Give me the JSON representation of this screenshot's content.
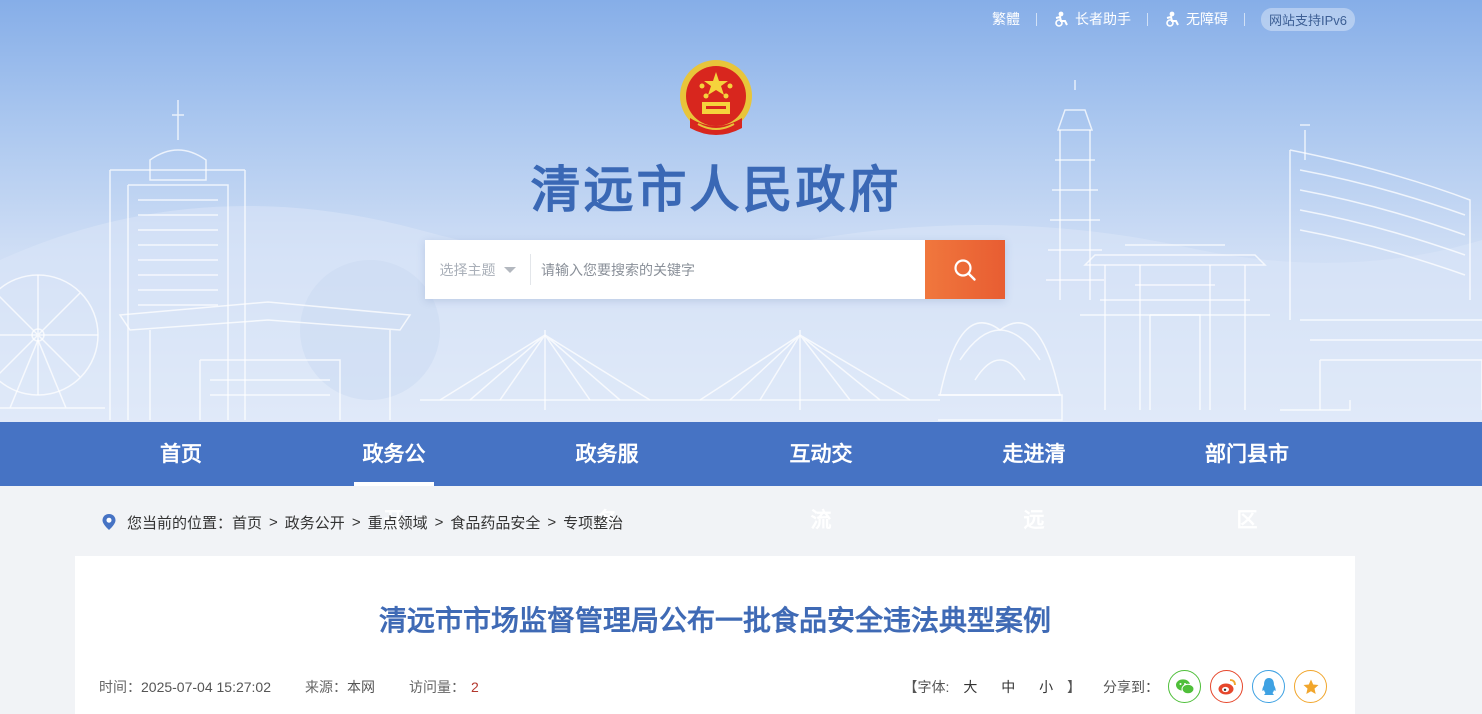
{
  "toplinks": {
    "traditional": "繁體",
    "elder": "长者助手",
    "accessible": "无障碍",
    "ipv6": "网站支持IPv6"
  },
  "site": {
    "title": "清远市人民政府"
  },
  "search": {
    "topic": "选择主题",
    "placeholder": "请输入您要搜索的关键字"
  },
  "nav": {
    "items": [
      {
        "label": "首页"
      },
      {
        "label": "政务公开"
      },
      {
        "label": "政务服务"
      },
      {
        "label": "互动交流"
      },
      {
        "label": "走进清远"
      },
      {
        "label": "部门县市区"
      }
    ],
    "active": "政务公开"
  },
  "breadcrumb": {
    "prefix": "您当前的位置：",
    "items": [
      "首页",
      "政务公开",
      "重点领域",
      "食品药品安全",
      "专项整治"
    ],
    "sep": ">"
  },
  "article": {
    "title": "清远市市场监督管理局公布一批食品安全违法典型案例",
    "time_label": "时间：",
    "time": "2025-07-04 15:27:02",
    "source_label": "来源：",
    "source": "本网",
    "views_label": "访问量：",
    "views": "2",
    "font_label_open": "【字体:",
    "font_large": "大",
    "font_medium": "中",
    "font_small": "小",
    "font_label_close": "】",
    "share_label": "分享到："
  },
  "colors": {
    "nav": "#4673c4",
    "title": "#3f6ab5",
    "search_button": "#ec6635",
    "wechat": "#4fbf3a",
    "weibo": "#e6472c",
    "qq": "#3fa2e3",
    "favorite": "#f1a62c"
  },
  "icons": [
    "accessibility-icon",
    "accessibility-icon",
    "search-icon",
    "location-pin-icon",
    "wechat-icon",
    "weibo-icon",
    "qq-icon",
    "star-icon",
    "national-emblem"
  ]
}
